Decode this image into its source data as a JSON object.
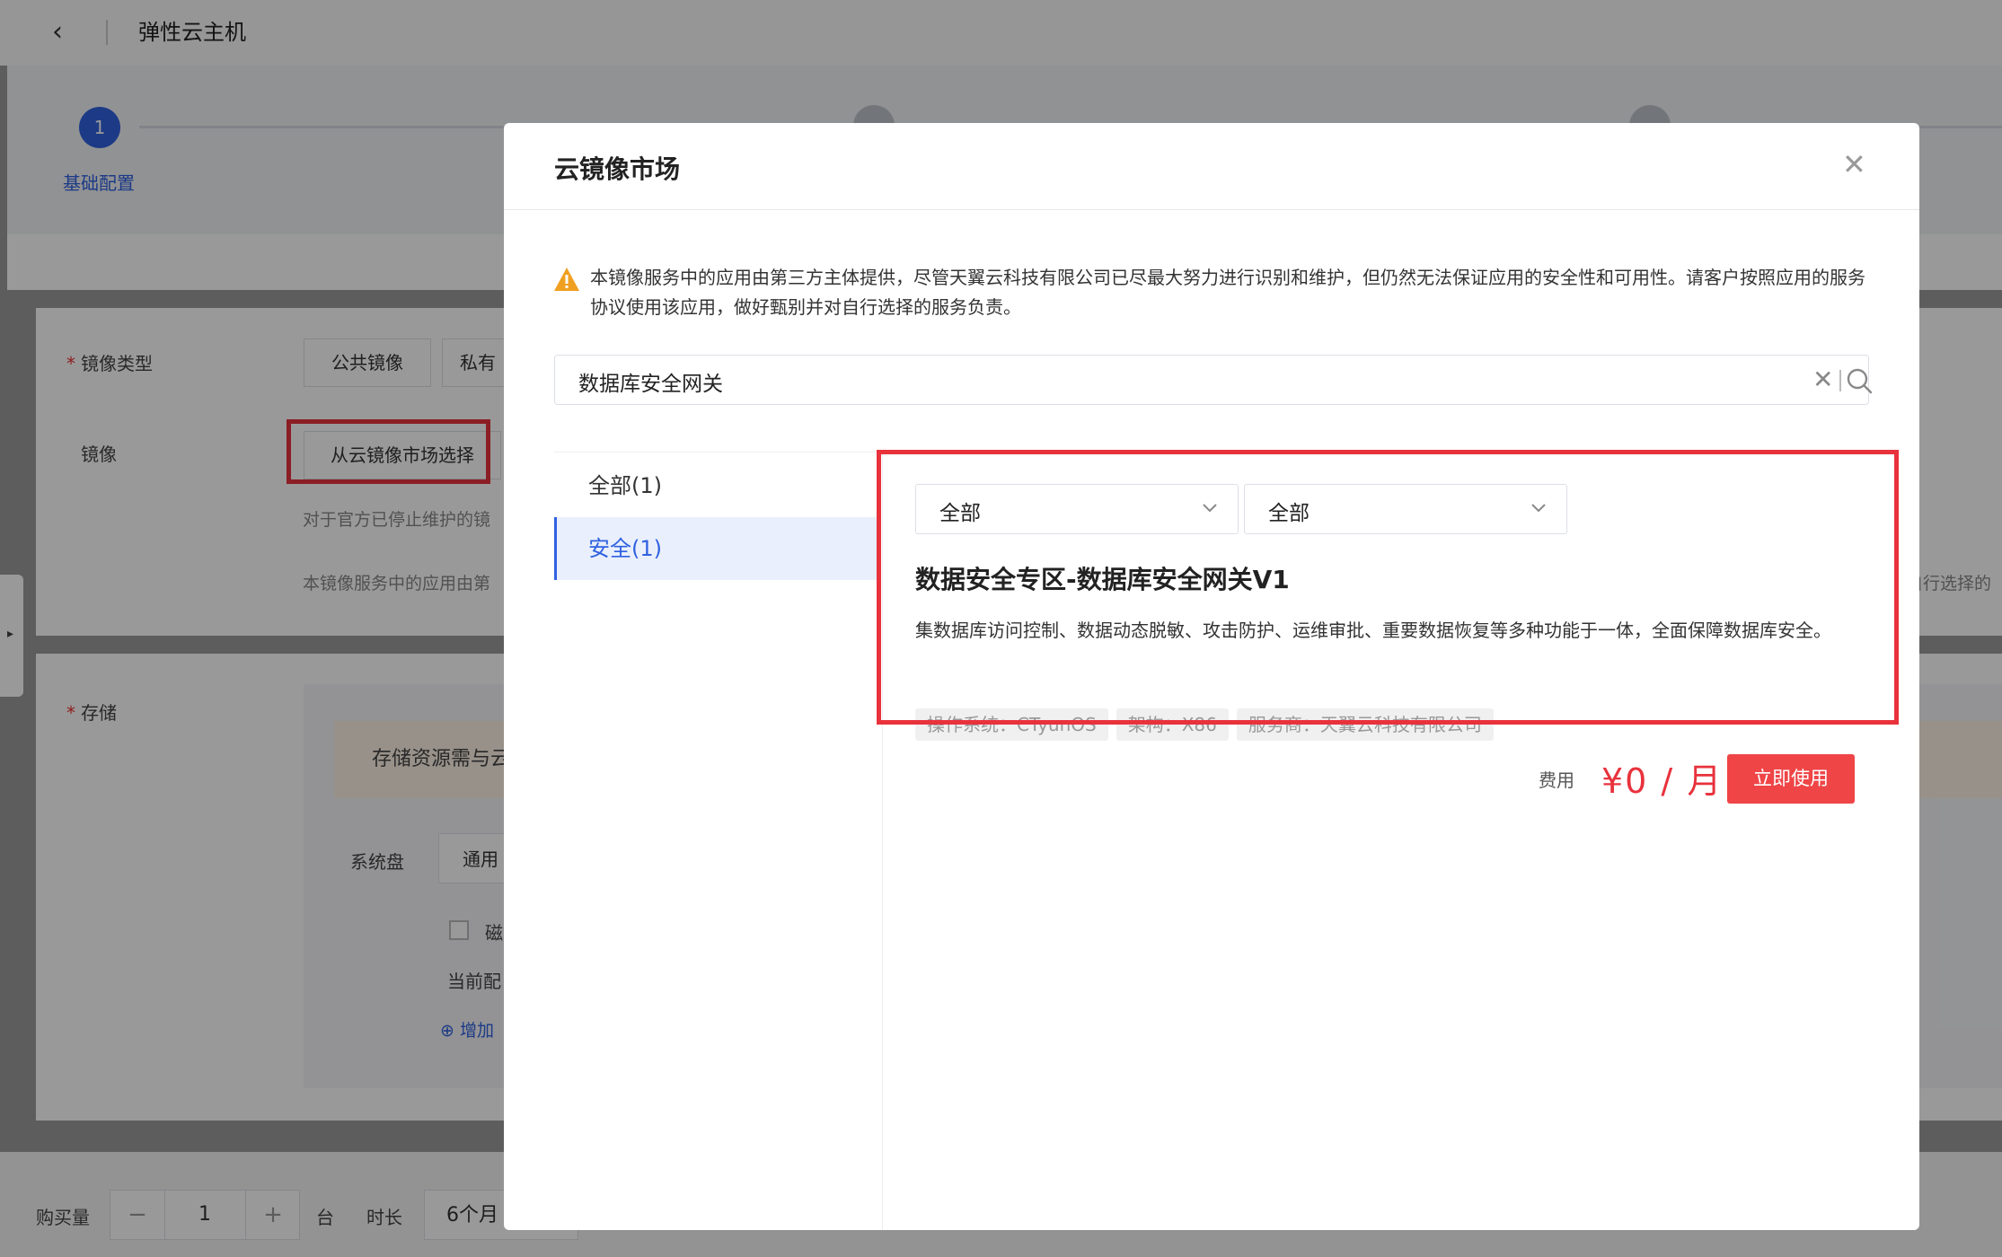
{
  "header": {
    "back_icon": "chevron-left-icon",
    "title": "弹性云主机"
  },
  "steps": [
    {
      "number": "1",
      "label": "基础配置",
      "state": "active",
      "color": "#2f61e0"
    }
  ],
  "image_section": {
    "image_type_label": "镜像类型",
    "image_type_options": [
      "公共镜像",
      "私有"
    ],
    "image_label": "镜像",
    "market_button": "从云镜像市场选择",
    "notice_1": "对于官方已停止维护的镜",
    "notice_2": "本镜像服务中的应用由第",
    "notice_2_tail": "自行选择的"
  },
  "storage_section": {
    "label": "存储",
    "warning": "存储资源需与云",
    "system_disk_label": "系统盘",
    "disk_type": "通用",
    "checkbox_label": "磁",
    "current_config": "当前配",
    "add_label": "增加"
  },
  "purchase_bar": {
    "quantity_label": "购买量",
    "quantity": "1",
    "minus": "−",
    "plus": "+",
    "unit": "台",
    "duration_label": "时长",
    "duration": "6个月"
  },
  "modal": {
    "title": "云镜像市场",
    "close_icon": "close-icon",
    "warning_text": "本镜像服务中的应用由第三方主体提供，尽管天翼云科技有限公司已尽最大努力进行识别和维护，但仍然无法保证应用的安全性和可用性。请客户按照应用的服务协议使用该应用，做好甄别并对自行选择的服务负责。",
    "search": {
      "value": "数据库安全网关",
      "clear_icon": "clear-icon",
      "search_icon": "search-icon"
    },
    "categories": [
      {
        "label": "全部(1)",
        "active": false
      },
      {
        "label": "安全(1)",
        "active": true
      }
    ],
    "filters": [
      "全部",
      "全部"
    ],
    "product": {
      "title": "数据安全专区-数据库安全网关V1",
      "description": "集数据库访问控制、数据动态脱敏、攻击防护、运维审批、重要数据恢复等多种功能于一体，全面保障数据库安全。",
      "tags": [
        "操作系统：CTyunOS",
        "架构：X86",
        "服务商：天翼云科技有限公司"
      ],
      "fee_label": "费用",
      "price": "¥0 / 月",
      "use_button": "立即使用"
    }
  },
  "colors": {
    "accent": "#2f61e0",
    "danger": "#e8323c",
    "warning": "#f0a020"
  }
}
